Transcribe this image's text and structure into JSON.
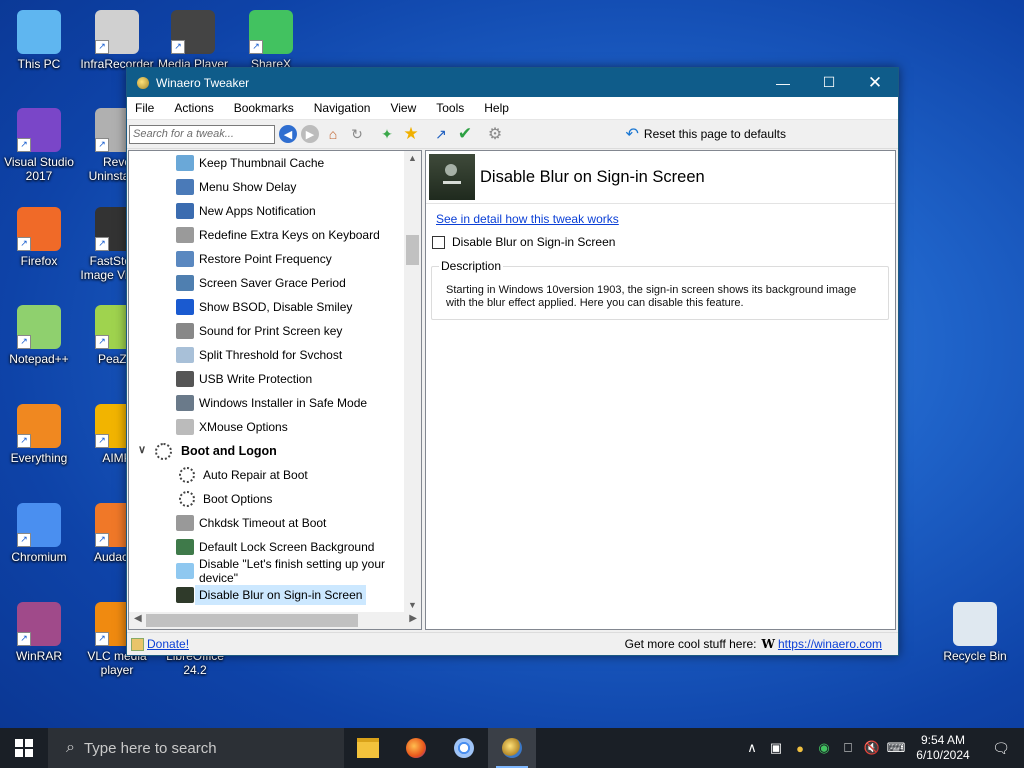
{
  "desktop_icons": [
    {
      "label": "This PC",
      "color": "#5fb6f0"
    },
    {
      "label": "InfraRecorder",
      "color": "#d0d0d0"
    },
    {
      "label": "Media Player",
      "color": "#444"
    },
    {
      "label": "ShareX",
      "color": "#42c260"
    },
    {
      "label": "Visual Studio 2017",
      "color": "#7a46c8"
    },
    {
      "label": "Revo Uninstaller",
      "color": "#b0b0b0"
    },
    {
      "label": "Firefox",
      "color": "#f06a28"
    },
    {
      "label": "FastStone Image Viewer",
      "color": "#333"
    },
    {
      "label": "Notepad++",
      "color": "#8fd06e"
    },
    {
      "label": "PeaZip",
      "color": "#9fd34e"
    },
    {
      "label": "Everything",
      "color": "#f08820"
    },
    {
      "label": "AIMP",
      "color": "#f2b400"
    },
    {
      "label": "Chromium",
      "color": "#4a8ff0"
    },
    {
      "label": "Audacity",
      "color": "#f07828"
    },
    {
      "label": "WinRAR",
      "color": "#a04a8a"
    },
    {
      "label": "VLC media player",
      "color": "#f08a10"
    },
    {
      "label": "LibreOffice 24.2",
      "color": "#ffffff"
    },
    {
      "label": "Recycle Bin",
      "color": "#dfe8f0"
    }
  ],
  "window": {
    "title": "Winaero Tweaker",
    "menu": [
      "File",
      "Actions",
      "Bookmarks",
      "Navigation",
      "View",
      "Tools",
      "Help"
    ],
    "search_placeholder": "Search for a tweak...",
    "reset_label": "Reset this page to defaults",
    "tree": [
      {
        "label": "Keep Thumbnail Cache",
        "type": "item",
        "color": "#6aa8d8"
      },
      {
        "label": "Menu Show Delay",
        "type": "item",
        "color": "#4a7ab8"
      },
      {
        "label": "New Apps Notification",
        "type": "item",
        "color": "#3b6cb0"
      },
      {
        "label": "Redefine Extra Keys on Keyboard",
        "type": "item",
        "color": "#9a9a9a"
      },
      {
        "label": "Restore Point Frequency",
        "type": "item",
        "color": "#5a88c0"
      },
      {
        "label": "Screen Saver Grace Period",
        "type": "item",
        "color": "#4f7fb0"
      },
      {
        "label": "Show BSOD, Disable Smiley",
        "type": "item",
        "color": "#1a5ad0"
      },
      {
        "label": "Sound for Print Screen key",
        "type": "item",
        "color": "#888"
      },
      {
        "label": "Split Threshold for Svchost",
        "type": "item",
        "color": "#a8c0d8"
      },
      {
        "label": "USB Write Protection",
        "type": "item",
        "color": "#555"
      },
      {
        "label": "Windows Installer in Safe Mode",
        "type": "item",
        "color": "#6a7a8a"
      },
      {
        "label": "XMouse Options",
        "type": "item",
        "color": "#bbb"
      },
      {
        "label": "Boot and Logon",
        "type": "cat"
      },
      {
        "label": "Auto Repair at Boot",
        "type": "sub"
      },
      {
        "label": "Boot Options",
        "type": "sub"
      },
      {
        "label": "Chkdsk Timeout at Boot",
        "type": "item",
        "color": "#999"
      },
      {
        "label": "Default Lock Screen Background",
        "type": "item",
        "color": "#3f7a4a"
      },
      {
        "label": "Disable \"Let's finish setting up your device\"",
        "type": "item",
        "color": "#8fc8f0"
      },
      {
        "label": "Disable Blur on Sign-in Screen",
        "type": "item",
        "color": "#2f3a2a",
        "selected": true
      }
    ],
    "content": {
      "title": "Disable Blur on Sign-in Screen",
      "link": "See in detail how this tweak works",
      "checkbox_label": "Disable Blur on Sign-in Screen",
      "checked": false,
      "desc_legend": "Description",
      "desc_text": "Starting in Windows 10version 1903, the sign-in screen shows its background image with the blur effect applied. Here you can disable this feature."
    },
    "status": {
      "donate": "Donate!",
      "more": "Get more cool stuff here:",
      "w": "W",
      "url": "https://winaero.com"
    }
  },
  "taskbar": {
    "search_placeholder": "Type here to search",
    "time": "9:54 AM",
    "date": "6/10/2024"
  }
}
